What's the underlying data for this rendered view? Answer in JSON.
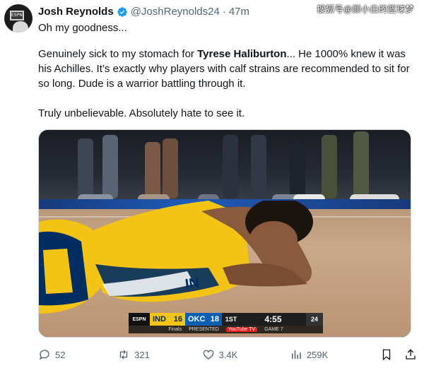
{
  "watermark": "搜狐号@颜小白的篮球梦",
  "author": {
    "name": "Josh Reynolds",
    "handle": "@JoshReynolds24",
    "separator": "·",
    "time": "47m",
    "avatar_label": "ESPN"
  },
  "tweet": {
    "line1": "Oh my goodness...",
    "para1_pre": "Genuinely sick to my stomach for ",
    "para1_bold": "Tyrese Haliburton",
    "para1_post": "... He 1000% knew it was his Achilles. It’s exactly why players with calf strains are recommended to sit for so long. Dude is a warrior battling through it.",
    "para2": "Truly unbelievable. Absolutely hate to see it."
  },
  "scorebug": {
    "network": "ESPN",
    "team1": "IND",
    "score1": "16",
    "team2": "OKC",
    "score2": "18",
    "quarter": "1ST",
    "clock": "4:55",
    "shot_clock": "24",
    "finals": "Finals",
    "presented": "PRESENTED",
    "sponsor": "YouTube TV",
    "game": "GAME 7"
  },
  "jersey": {
    "text": "IN"
  },
  "actions": {
    "replies": "52",
    "reposts": "321",
    "likes": "3.4K",
    "views": "259K"
  },
  "icons": [
    "verified-badge-icon",
    "reply-icon",
    "repost-icon",
    "like-icon",
    "views-icon",
    "bookmark-icon",
    "share-icon"
  ],
  "colors": {
    "verified": "#1d9bf0",
    "text_secondary": "#536471",
    "pacers_gold": "#f3c316",
    "pacers_navy": "#002d62",
    "thunder_blue": "#0a5fb4"
  }
}
